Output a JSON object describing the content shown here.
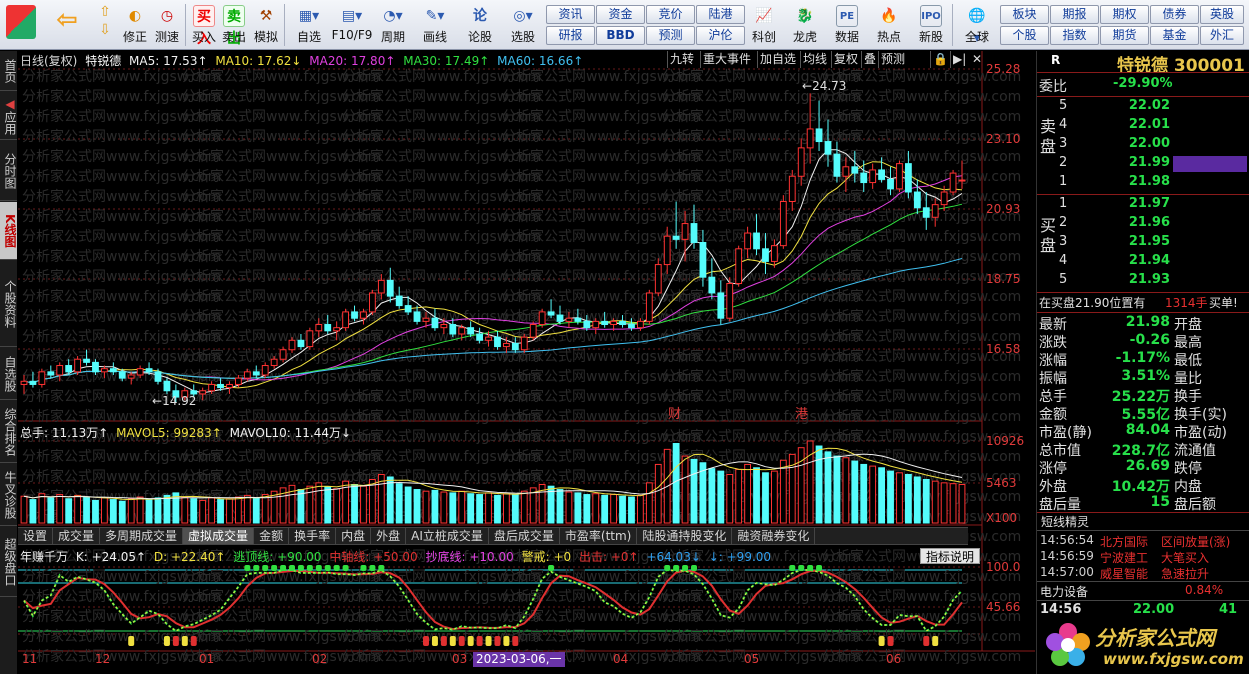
{
  "toolbar": {
    "buttons": [
      "买入",
      "卖出",
      "模拟",
      "修正",
      "测速"
    ],
    "nav_labels": [
      "自选",
      "F10/F9",
      "周期",
      "画线",
      "论股",
      "选股"
    ],
    "right_labels": [
      "科创",
      "龙虎",
      "数据",
      "热点",
      "新股",
      "全球"
    ],
    "grid_buttons": [
      "资讯",
      "资金",
      "竞价",
      "陆港",
      "研报",
      "BBD",
      "预测",
      "沪伦",
      "板块",
      "期报",
      "期权",
      "债券",
      "英股",
      "个股",
      "指数",
      "期货",
      "基金",
      "外汇"
    ]
  },
  "left_tabs": [
    "首页",
    "应用",
    "分时图",
    "K线图",
    "个股资料",
    "自选股",
    "综合排名",
    "牛叉诊股",
    "超级盘口"
  ],
  "left_tab_active": "K线图",
  "main_legend": {
    "period": "日线(复权)",
    "stock": "特锐德",
    "ma5": "MA5: 17.53↑",
    "ma10": "MA10: 17.62↓",
    "ma20": "MA20: 17.80↑",
    "ma30": "MA30: 17.49↑",
    "ma60": "MA60: 16.66↑"
  },
  "top_right_buttons": [
    "九转",
    "重大事件",
    "加自选",
    "均线",
    "复权",
    "叠",
    "预测"
  ],
  "price_axis": [
    "25.28",
    "23.10",
    "20.93",
    "18.75",
    "16.58"
  ],
  "annotations": {
    "high": "24.73",
    "low": "14.92",
    "marker_cai": "财",
    "marker_gang": "港"
  },
  "volume_legend": {
    "total": "总手: 11.13万↑",
    "mavol5": "MAVOL5: 99283↑",
    "mavol10": "MAVOL10: 11.44万↓"
  },
  "volume_axis": [
    "10926",
    "5463",
    "X100"
  ],
  "sub_tabs": [
    "设置",
    "成交量",
    "多周期成交量",
    "虚拟成交量",
    "金额",
    "换手率",
    "内盘",
    "外盘",
    "AI立桩成交量",
    "盘后成交量",
    "市盈率(ttm)",
    "陆股通持股变化",
    "融资融券变化"
  ],
  "sub_tab_active": "虚拟成交量",
  "indicator_legend": {
    "name": "年赚千万",
    "k": "K: +24.05↑",
    "d": "D: +22.40↑",
    "escape": "逃顶线: +90.00",
    "mid": "中轴线: +50.00",
    "bottom": "抄底线: +10.00",
    "warn": "警戒: +0",
    "out": "出击: +0↑",
    "v1": "+64.03↓",
    "v2": "↓: +99.00"
  },
  "indicator_axis": [
    "100.0",
    "45.66"
  ],
  "indicator_button": "指标说明",
  "months": [
    "11",
    "12",
    "01",
    "02",
    "03",
    "04",
    "05",
    "06"
  ],
  "cursor_date": "2023-03-06,一",
  "chart_data": {
    "type": "candlestick",
    "title": "特锐德 日线(复权)",
    "y_range": [
      14.5,
      25.5
    ],
    "candles": [
      [
        15.5,
        15.8,
        15.2,
        15.6
      ],
      [
        15.6,
        15.9,
        15.4,
        15.5
      ],
      [
        15.5,
        16.0,
        15.4,
        15.9
      ],
      [
        15.9,
        16.1,
        15.7,
        15.8
      ],
      [
        15.8,
        16.2,
        15.6,
        16.1
      ],
      [
        16.1,
        16.3,
        15.8,
        15.9
      ],
      [
        15.9,
        16.4,
        15.8,
        16.3
      ],
      [
        16.3,
        16.6,
        16.1,
        16.2
      ],
      [
        16.2,
        16.3,
        15.8,
        15.9
      ],
      [
        15.9,
        16.1,
        15.7,
        16.0
      ],
      [
        16.0,
        16.2,
        15.8,
        15.9
      ],
      [
        15.9,
        16.0,
        15.6,
        15.7
      ],
      [
        15.7,
        15.9,
        15.5,
        15.8
      ],
      [
        15.8,
        16.1,
        15.7,
        16.0
      ],
      [
        16.0,
        16.2,
        15.8,
        15.9
      ],
      [
        15.9,
        16.0,
        15.5,
        15.6
      ],
      [
        15.6,
        15.7,
        15.2,
        15.3
      ],
      [
        15.3,
        15.5,
        14.92,
        15.1
      ],
      [
        15.1,
        15.4,
        15.0,
        15.3
      ],
      [
        15.3,
        15.5,
        15.1,
        15.2
      ],
      [
        15.2,
        15.4,
        15.0,
        15.3
      ],
      [
        15.3,
        15.6,
        15.2,
        15.5
      ],
      [
        15.5,
        15.7,
        15.3,
        15.4
      ],
      [
        15.4,
        15.6,
        15.2,
        15.5
      ],
      [
        15.5,
        15.8,
        15.4,
        15.7
      ],
      [
        15.7,
        16.0,
        15.6,
        15.9
      ],
      [
        15.9,
        16.1,
        15.7,
        15.8
      ],
      [
        15.8,
        16.2,
        15.7,
        16.1
      ],
      [
        16.1,
        16.4,
        16.0,
        16.3
      ],
      [
        16.3,
        16.7,
        16.2,
        16.6
      ],
      [
        16.6,
        17.0,
        16.5,
        16.9
      ],
      [
        16.9,
        17.1,
        16.6,
        16.7
      ],
      [
        16.7,
        17.3,
        16.6,
        17.2
      ],
      [
        17.2,
        17.6,
        17.0,
        17.4
      ],
      [
        17.4,
        17.7,
        17.1,
        17.2
      ],
      [
        17.2,
        17.5,
        16.9,
        17.3
      ],
      [
        17.3,
        17.9,
        17.2,
        17.8
      ],
      [
        17.8,
        18.0,
        17.5,
        17.6
      ],
      [
        17.6,
        17.9,
        17.4,
        17.8
      ],
      [
        17.8,
        18.5,
        17.7,
        18.4
      ],
      [
        18.4,
        19.0,
        18.2,
        18.8
      ],
      [
        18.8,
        19.2,
        18.1,
        18.3
      ],
      [
        18.3,
        18.6,
        17.9,
        18.0
      ],
      [
        18.0,
        18.3,
        17.7,
        17.8
      ],
      [
        17.8,
        18.0,
        17.4,
        17.5
      ],
      [
        17.5,
        17.8,
        17.3,
        17.6
      ],
      [
        17.6,
        17.9,
        17.2,
        17.3
      ],
      [
        17.3,
        17.6,
        17.1,
        17.4
      ],
      [
        17.4,
        17.6,
        17.0,
        17.1
      ],
      [
        17.1,
        17.4,
        16.9,
        17.3
      ],
      [
        17.3,
        17.5,
        17.0,
        17.1
      ],
      [
        17.1,
        17.3,
        16.8,
        16.9
      ],
      [
        16.9,
        17.2,
        16.7,
        17.0
      ],
      [
        17.0,
        17.2,
        16.6,
        16.7
      ],
      [
        16.7,
        17.0,
        16.5,
        16.8
      ],
      [
        16.8,
        17.0,
        16.5,
        16.6
      ],
      [
        16.6,
        17.1,
        16.5,
        17.0
      ],
      [
        17.0,
        17.5,
        16.9,
        17.4
      ],
      [
        17.4,
        17.9,
        17.3,
        17.8
      ],
      [
        17.8,
        18.2,
        17.6,
        17.7
      ],
      [
        17.7,
        18.0,
        17.4,
        17.5
      ],
      [
        17.5,
        17.8,
        17.3,
        17.6
      ],
      [
        17.6,
        17.9,
        17.4,
        17.5
      ],
      [
        17.5,
        17.7,
        17.2,
        17.3
      ],
      [
        17.3,
        17.6,
        17.1,
        17.5
      ],
      [
        17.5,
        17.8,
        17.3,
        17.4
      ],
      [
        17.4,
        17.6,
        17.2,
        17.5
      ],
      [
        17.5,
        17.7,
        17.3,
        17.4
      ],
      [
        17.4,
        17.6,
        17.2,
        17.3
      ],
      [
        17.3,
        17.6,
        17.2,
        17.5
      ],
      [
        17.5,
        18.5,
        17.4,
        18.4
      ],
      [
        18.4,
        19.5,
        18.3,
        19.3
      ],
      [
        19.3,
        20.5,
        19.0,
        20.2
      ],
      [
        20.2,
        21.3,
        19.8,
        20.1
      ],
      [
        20.1,
        21.0,
        19.4,
        20.6
      ],
      [
        20.6,
        21.2,
        19.8,
        20.0
      ],
      [
        20.0,
        20.4,
        18.6,
        18.9
      ],
      [
        18.9,
        19.5,
        18.2,
        18.4
      ],
      [
        18.4,
        18.8,
        17.4,
        17.6
      ],
      [
        17.6,
        18.9,
        17.5,
        18.7
      ],
      [
        18.7,
        19.9,
        18.6,
        19.8
      ],
      [
        19.8,
        20.5,
        19.5,
        20.3
      ],
      [
        20.3,
        20.9,
        19.6,
        19.8
      ],
      [
        19.8,
        20.3,
        19.0,
        19.4
      ],
      [
        19.4,
        20.1,
        19.2,
        19.9
      ],
      [
        19.9,
        21.5,
        19.8,
        21.3
      ],
      [
        21.3,
        22.3,
        21.0,
        22.1
      ],
      [
        22.1,
        23.3,
        21.8,
        23.0
      ],
      [
        23.0,
        24.73,
        22.5,
        23.6
      ],
      [
        23.6,
        24.5,
        22.9,
        23.2
      ],
      [
        23.2,
        23.9,
        22.4,
        22.8
      ],
      [
        22.8,
        23.2,
        21.9,
        22.1
      ],
      [
        22.1,
        22.7,
        21.6,
        22.4
      ],
      [
        22.4,
        22.9,
        21.9,
        22.2
      ],
      [
        22.2,
        22.6,
        21.6,
        21.9
      ],
      [
        21.9,
        22.5,
        21.7,
        22.3
      ],
      [
        22.3,
        22.7,
        21.9,
        22.0
      ],
      [
        22.0,
        22.4,
        21.5,
        21.7
      ],
      [
        21.7,
        22.6,
        21.6,
        22.5
      ],
      [
        22.5,
        22.9,
        21.4,
        21.6
      ],
      [
        21.6,
        22.0,
        20.9,
        21.1
      ],
      [
        21.1,
        21.6,
        20.4,
        20.8
      ],
      [
        20.8,
        21.4,
        20.5,
        21.2
      ],
      [
        21.2,
        21.8,
        21.0,
        21.6
      ],
      [
        21.6,
        22.3,
        21.5,
        22.2
      ],
      [
        21.98,
        22.6,
        21.7,
        21.98
      ]
    ],
    "volume": [
      32,
      28,
      35,
      30,
      34,
      29,
      33,
      31,
      27,
      30,
      28,
      26,
      29,
      31,
      28,
      30,
      33,
      36,
      31,
      29,
      27,
      30,
      28,
      29,
      31,
      33,
      30,
      34,
      38,
      42,
      45,
      40,
      44,
      48,
      43,
      41,
      50,
      46,
      44,
      52,
      58,
      55,
      47,
      43,
      40,
      38,
      39,
      37,
      36,
      38,
      35,
      34,
      36,
      33,
      35,
      34,
      38,
      42,
      46,
      44,
      40,
      37,
      36,
      34,
      35,
      33,
      34,
      32,
      31,
      33,
      48,
      70,
      88,
      95,
      80,
      76,
      72,
      65,
      62,
      58,
      64,
      70,
      66,
      60,
      62,
      75,
      82,
      90,
      98,
      92,
      85,
      80,
      78,
      74,
      70,
      68,
      66,
      62,
      60,
      58,
      55,
      52,
      50,
      48,
      47,
      46
    ],
    "ma_lines": [
      "MA5",
      "MA10",
      "MA20",
      "MA30",
      "MA60"
    ]
  },
  "order_book": {
    "title_r": "R",
    "stock": "特锐德 300001",
    "weibi_label": "委比",
    "weibi_value": "-29.90%",
    "sell_label": "卖盘",
    "buy_label": "买盘",
    "sell": [
      [
        "5",
        "22.02"
      ],
      [
        "4",
        "22.01"
      ],
      [
        "3",
        "22.00"
      ],
      [
        "2",
        "21.99"
      ],
      [
        "1",
        "21.98"
      ]
    ],
    "buy": [
      [
        "1",
        "21.97"
      ],
      [
        "2",
        "21.96"
      ],
      [
        "3",
        "21.95"
      ],
      [
        "4",
        "21.94"
      ],
      [
        "5",
        "21.93"
      ]
    ],
    "note_left": "在买盘21.90位置有",
    "note_vol": "1314手",
    "note_right": "买单!"
  },
  "quote": [
    [
      "最新",
      "21.98",
      "开盘"
    ],
    [
      "涨跌",
      "-0.26",
      "最高"
    ],
    [
      "涨幅",
      "-1.17%",
      "最低"
    ],
    [
      "振幅",
      "3.51%",
      "量比"
    ],
    [
      "总手",
      "25.22万",
      "换手"
    ],
    [
      "金额",
      "5.55亿",
      "换手(实)"
    ],
    [
      "市盈(静)",
      "84.04",
      "市盈(动)"
    ],
    [
      "总市值",
      "228.7亿",
      "流通值"
    ],
    [
      "涨停",
      "26.69",
      "跌停"
    ],
    [
      "外盘",
      "10.42万",
      "内盘"
    ],
    [
      "盘后量",
      "15",
      "盘后额"
    ]
  ],
  "wizard": {
    "title": "短线精灵",
    "rows": [
      [
        "14:56:54",
        "北方国际",
        "区间放量(涨)"
      ],
      [
        "14:56:59",
        "宁波建工",
        "大笔买入"
      ],
      [
        "14:57:00",
        "威星智能",
        "急速拉升"
      ]
    ]
  },
  "sector": {
    "name": "电力设备",
    "pct": "0.84%"
  },
  "tick": {
    "time": "14:56",
    "price": "22.00",
    "vol": "41"
  },
  "logo": {
    "cn": "分析家公式网",
    "url": "www.fxjgsw.com"
  },
  "watermark": "分析家公式网www.fxjgsw.com"
}
